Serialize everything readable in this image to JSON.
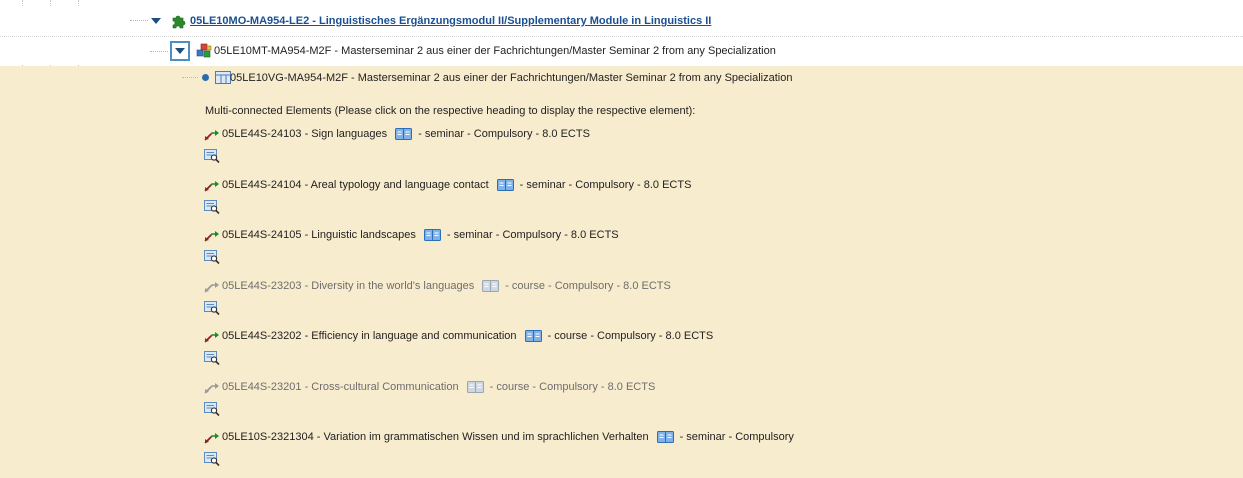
{
  "tree": {
    "module": {
      "label": "05LE10MO-MA954-LE2 - Linguistisches Ergänzungsmodul II/Supplementary Module in Linguistics II",
      "icon": "puzzle-icon"
    },
    "submodule": {
      "label": "05LE10MT-MA954-M2F - Masterseminar 2 aus einer der Fachrichtungen/Master Seminar 2 from any Specialization",
      "icon": "blocks-icon"
    },
    "event": {
      "label": "05LE10VG-MA954-M2F - Masterseminar 2 aus einer der Fachrichtungen/Master Seminar 2 from any Specialization",
      "icon": "folder-icon"
    },
    "multi_connected_label": "Multi-connected Elements (Please click on the respective heading to display the respective element):",
    "courses": [
      {
        "code": "05LE44S-24103 - Sign languages",
        "after": "- seminar - Compulsory - 8.0 ECTS",
        "muted": false
      },
      {
        "code": "05LE44S-24104 - Areal typology and language contact",
        "after": "- seminar - Compulsory - 8.0 ECTS",
        "muted": false
      },
      {
        "code": "05LE44S-24105 - Linguistic landscapes",
        "after": "- seminar - Compulsory - 8.0 ECTS",
        "muted": false
      },
      {
        "code": "05LE44S-23203 - Diversity in the world's languages",
        "after": "- course - Compulsory - 8.0 ECTS",
        "muted": true
      },
      {
        "code": "05LE44S-23202 - Efficiency in language and communication",
        "after": "- course - Compulsory - 8.0 ECTS",
        "muted": false
      },
      {
        "code": "05LE44S-23201 - Cross-cultural Communication",
        "after": "- course - Compulsory - 8.0 ECTS",
        "muted": true
      },
      {
        "code": "05LE10S-2321304 - Variation im grammatischen Wissen und im sprachlichen Verhalten",
        "after": "- seminar - Compulsory",
        "muted": false
      }
    ]
  },
  "colors": {
    "highlight_bg": "#f8ecce",
    "link": "#1a4f92",
    "toggle_border": "#4a90c8",
    "arrow_green": "#1c8a2a",
    "arrow_red": "#a01a2a"
  }
}
